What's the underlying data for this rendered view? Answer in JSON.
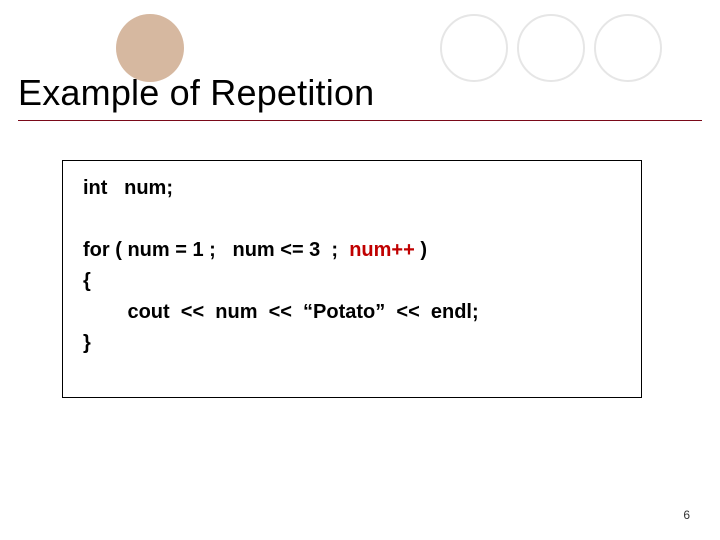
{
  "title": "Example of Repetition",
  "code": {
    "decl": "int   num;",
    "for_kw": "for",
    "for_open": " ( ",
    "for_init": "num = 1 ;",
    "for_gap1": "   ",
    "for_cond": "num <= 3  ;",
    "for_gap2": "  ",
    "for_update": "num++",
    "for_close": " ) ",
    "brace_open": "{",
    "body_indent": "        ",
    "body_stmt": "cout  <<  num  <<  “Potato”  <<  endl;",
    "brace_close": "}"
  },
  "page_number": "6",
  "decor": {
    "circle_fill": "#d6b8a0",
    "circle_stroke": "#e6e6e6",
    "rule_color": "#7a0919",
    "update_color": "#c00000"
  }
}
